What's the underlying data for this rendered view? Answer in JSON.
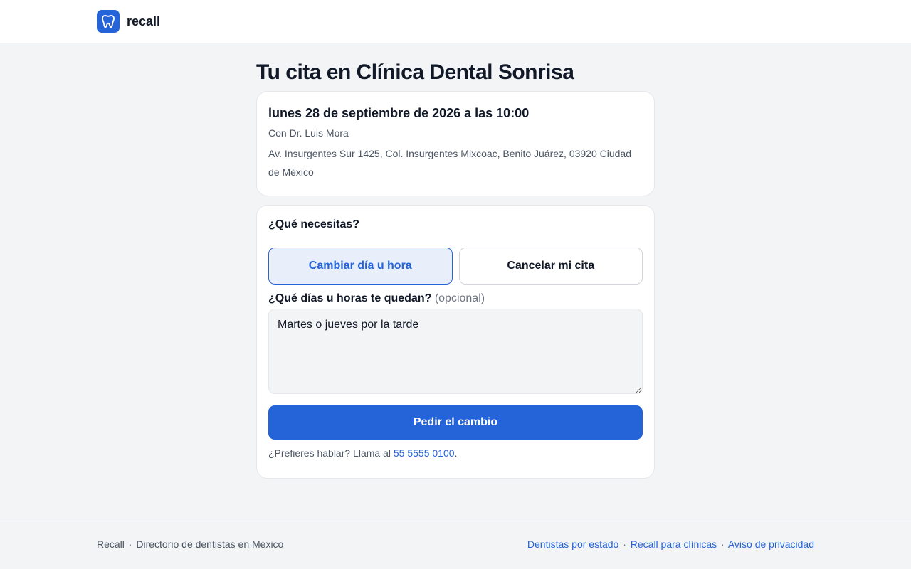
{
  "header": {
    "brand_name": "recall",
    "logo_icon": "tooth-icon",
    "brand_color": "#2563d9"
  },
  "main": {
    "title": "Tu cita en Clínica Dental Sonrisa",
    "appointment": {
      "datetime": "lunes 28 de septiembre de 2026 a las 10:00",
      "doctor": "Con Dr. Luis Mora",
      "address": "Av. Insurgentes Sur 1425, Col. Insurgentes Mixcoac, Benito Juárez, 03920 Ciudad de México"
    },
    "action": {
      "question": "¿Qué necesitas?",
      "options": [
        {
          "label": "Cambiar día u hora",
          "selected": true
        },
        {
          "label": "Cancelar mi cita",
          "selected": false
        }
      ],
      "availability_label": "¿Qué días u horas te quedan?",
      "availability_optional": "(opcional)",
      "availability_value": "Martes o jueves por la tarde",
      "submit_label": "Pedir el cambio",
      "call_prefix": "¿Prefieres hablar? Llama al",
      "call_phone": "55 5555 0100",
      "call_suffix": "."
    }
  },
  "footer": {
    "brand": "Recall",
    "separator": "·",
    "tagline": "Directorio de dentistas en México",
    "links": [
      "Dentistas por estado",
      "Recall para clínicas",
      "Aviso de privacidad"
    ]
  },
  "colors": {
    "accent": "#2563d9",
    "background": "#f3f4f6",
    "selected_bg": "#e8effb"
  }
}
